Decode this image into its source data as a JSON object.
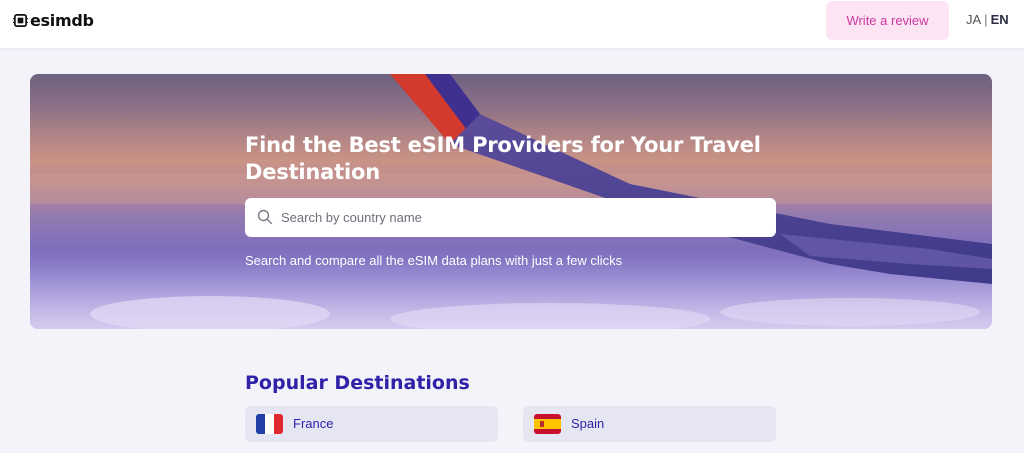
{
  "header": {
    "logo_text": "esimdb",
    "logo_icon": "sim-chip-icon",
    "review_button_label": "Write a review",
    "lang_ja": "JA",
    "lang_separator": "|",
    "lang_en": "EN"
  },
  "hero": {
    "title": "Find the Best eSIM Providers for Your Travel Destination",
    "search_placeholder": "Search by country name",
    "search_value": "",
    "subtitle": "Search and compare all the eSIM data plans with just a few clicks"
  },
  "popular": {
    "title": "Popular Destinations",
    "items": [
      {
        "name": "France",
        "flag": "france-flag-icon"
      },
      {
        "name": "Spain",
        "flag": "spain-flag-icon"
      }
    ]
  },
  "colors": {
    "accent": "#2f22a8",
    "review_bg": "#fde4f4",
    "review_text": "#c8399e",
    "page_bg": "#f4f3fa"
  }
}
